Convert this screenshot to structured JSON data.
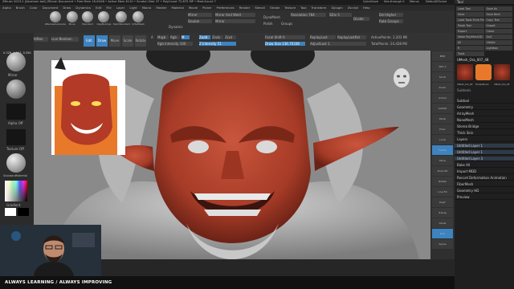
{
  "title_bar": {
    "text": "ZBrush 2023.2 [Abraham ball]  ZBrush Document  • Free Mem 18.04GB • Active Mem 6110 • Scratch Disk 37 • PolyCount 72.875 MP • MeshCount 7",
    "quicksave": "QuickSave",
    "seethrough": "See-through 0",
    "menus": "Menus",
    "default_script": "DefaultZScript"
  },
  "menu_bar": [
    "Alpha",
    "Brush",
    "Color",
    "Document",
    "Draw",
    "Dynamics",
    "Edit",
    "File",
    "Layer",
    "Light",
    "Macro",
    "Marker",
    "Material",
    "Movie",
    "Picker",
    "Preferences",
    "Render",
    "Stencil",
    "Stroke",
    "Texture",
    "Tool",
    "Transform",
    "Zplugin",
    "Zscript",
    "Help"
  ],
  "toolbar": {
    "brushes": [
      "ZRemesherGuide",
      "Move",
      "Standard",
      "ClayBuildup",
      "DamStandard",
      "InflatMesh"
    ],
    "mirror": {
      "mirror": "Mirror",
      "mirror_and_weld": "Mirror And Weld",
      "double": "Double",
      "mirror2": "Mirror"
    },
    "resolution": "Resolution 784",
    "sdiv": "SDiv 5",
    "divide": "Divide",
    "del_higher": "Del Higher",
    "dynamesh": "DynaMesh",
    "polish": "Polish",
    "groups": "Groups",
    "rate_groups": "Rate Groups",
    "dynamic": "Dynamic"
  },
  "toolbar2": {
    "home": "Home Page",
    "lightbox": "LightBox",
    "live_boolean": "Live Boolean",
    "edit": "Edit",
    "draw": "Draw",
    "move": "Move",
    "scale": "Scale",
    "rotate": "Rotate",
    "a_label": "A",
    "mrgb": "Mrgb",
    "rgb": "Rgb",
    "m": "M",
    "zadd": "Zadd",
    "zsub": "Zsub",
    "zcut": "Zcut",
    "rgb_intensity": "Rgb Intensity 100",
    "z_intensity": "Z Intensity 51",
    "focal_shift": "Focal Shift 0",
    "draw_size": "Draw Size 136.70338",
    "replay_last": "ReplayLast",
    "replay_last_rel": "ReplayLastRel",
    "active_points": "ActivePoints: 3.203 Mil",
    "total_points": "TotalPoints: 24.428 Mil",
    "adjust_last": "AdjustLast 1"
  },
  "left_panel": {
    "swatch1": "Mirror",
    "swatch2": "Alpha Off",
    "swatch3": "Texture Off",
    "swatch4": "StandardMaterial",
    "gradient": "Gradient",
    "switch_color": "SwitchColor",
    "alternate": "Alternate",
    "coord": "0.326,-1.507, 0.350"
  },
  "right_shelf": [
    "BPR",
    "SPix 3",
    "Scroll",
    "Zoom",
    "Actual",
    "AAHalf",
    "Persp",
    "Floor",
    "Local",
    "Frame",
    "Move",
    "Zoom3D",
    "Rotate",
    "Line Fill",
    "PolyF",
    "Transp",
    "Ghost",
    "Solo",
    "Xpose"
  ],
  "tool_panel": {
    "header": "Tool",
    "buttons": [
      "Load Tool",
      "Save As",
      "Save",
      "Save Next",
      "Load Tools From Project",
      "Copy Tool",
      "Paste Tool",
      "Import",
      "Export",
      "Clone",
      "Make PolyMesh3D",
      "GoZ",
      "All",
      "Visible",
      "R",
      "Lightbox",
      "Tools"
    ],
    "current_tool": "UMesh_Ora_007_48",
    "thumb_labels": [
      "UMesh_Ora_007",
      "SimpleBrush",
      "UMesh_Ora_007"
    ],
    "sections": [
      "Subtool",
      "Geometry",
      "ArrayMesh",
      "NanoMesh",
      "Stereo Bridge",
      "Thick Skin",
      "Layers",
      "Untitled Layer 1",
      "Untitled Layer 1",
      "Untitled Layer 3",
      "Bake All",
      "Import MDD",
      "Record Deformation Animation",
      "FiberMesh",
      "Geometry HD",
      "Preview"
    ],
    "subtools_label": "Subtools"
  },
  "ticker": "ALWAYS LEARNING  /  ALWAYS IMPROVING",
  "colors": {
    "accent": "#3d83c0",
    "skin": "#b9442f",
    "bg_dark": "#262626",
    "viewport": "#8c8c8c",
    "orange": "#e8792a"
  },
  "icons": [
    "brush-icon",
    "head-orientation-icon",
    "sphere-swatch-icon",
    "color-picker-icon",
    "webcam-presenter"
  ]
}
